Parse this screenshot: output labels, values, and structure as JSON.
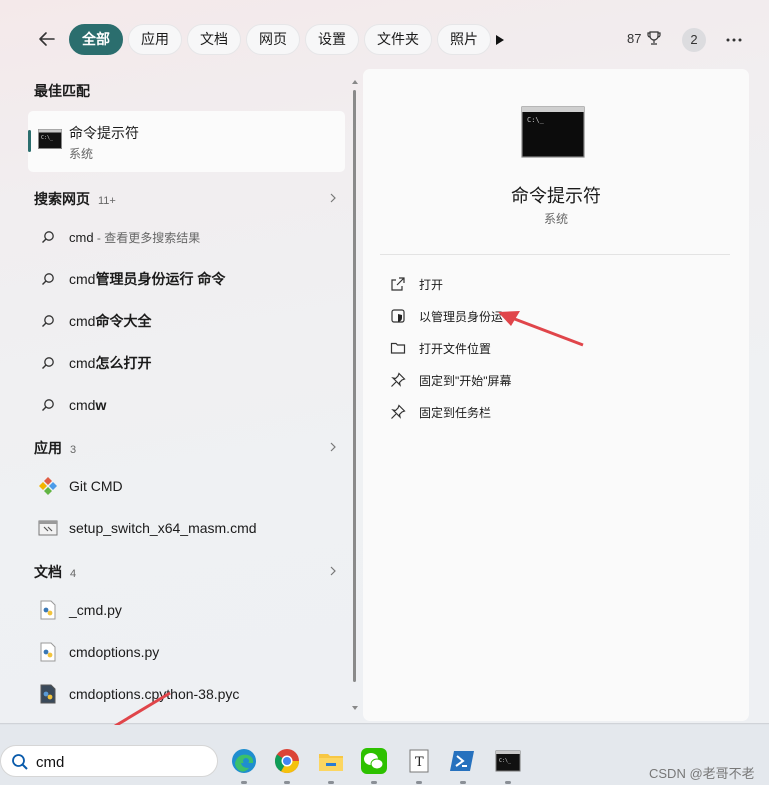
{
  "topbar": {
    "tabs": [
      "全部",
      "应用",
      "文档",
      "网页",
      "设置",
      "文件夹",
      "照片"
    ],
    "points": "87",
    "badge": "2"
  },
  "left": {
    "best_match_title": "最佳匹配",
    "best_match": {
      "title": "命令提示符",
      "subtitle": "系统"
    },
    "web_section": {
      "title": "搜索网页",
      "count": "11+"
    },
    "web_results": [
      {
        "bold": "cmd",
        "rest": " - 查看更多搜索结果"
      },
      {
        "bold": "cmd",
        "rest": "管理员身份运行 命令"
      },
      {
        "bold": "cmd",
        "rest": "命令大全"
      },
      {
        "bold": "cmd",
        "rest": "怎么打开"
      },
      {
        "bold": "cmd",
        "rest": "w"
      }
    ],
    "apps_section": {
      "title": "应用",
      "count": "3"
    },
    "apps": [
      "Git CMD",
      "setup_switch_x64_masm.cmd"
    ],
    "docs_section": {
      "title": "文档",
      "count": "4"
    },
    "docs": [
      "_cmd.py",
      "cmdoptions.py",
      "cmdoptions.cpython-38.pyc"
    ]
  },
  "right": {
    "title": "命令提示符",
    "subtitle": "系统",
    "actions": [
      "打开",
      "以管理员身份运",
      "打开文件位置",
      "固定到\"开始\"屏幕",
      "固定到任务栏"
    ]
  },
  "taskbar": {
    "search_value": "cmd",
    "watermark": "CSDN @老哥不老"
  },
  "colors": {
    "accent": "#2b6e6e",
    "arrow": "#e0454a"
  }
}
